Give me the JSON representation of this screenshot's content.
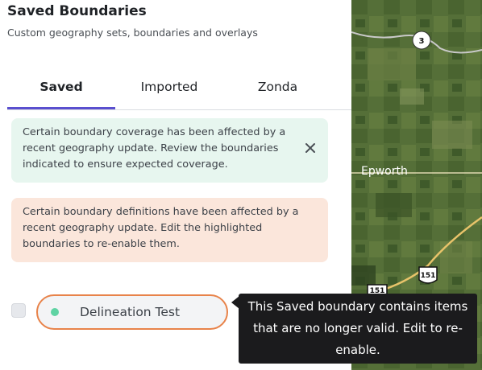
{
  "header": {
    "title": "Saved Boundaries",
    "subtitle": "Custom geography sets, boundaries and overlays"
  },
  "tabs": [
    {
      "label": "Saved",
      "active": true
    },
    {
      "label": "Imported",
      "active": false
    },
    {
      "label": "Zonda",
      "active": false
    }
  ],
  "alerts": {
    "info": {
      "message": "Certain boundary coverage has been affected by a recent geography update. Review the boundaries indicated to ensure expected coverage.",
      "close_icon": "close-icon",
      "color": "#e7f6ef"
    },
    "warning": {
      "message": "Certain boundary definitions have been affected by a recent geography update. Edit the highlighted boundaries to re-enable them.",
      "color": "#fbe6db"
    }
  },
  "boundaries": [
    {
      "name": "Delineation Test",
      "checked": false,
      "status_color": "#5fd3a3",
      "highlight_color": "#e8834a"
    }
  ],
  "tooltip": {
    "text": "This Saved boundary contains items that are no longer valid. Edit to re-enable."
  },
  "map": {
    "place_label": "Epworth",
    "route_shields": [
      "3",
      "151",
      "151"
    ]
  },
  "colors": {
    "accent": "#5a4fcf",
    "warning_border": "#e8834a",
    "status_ok": "#5fd3a3"
  }
}
